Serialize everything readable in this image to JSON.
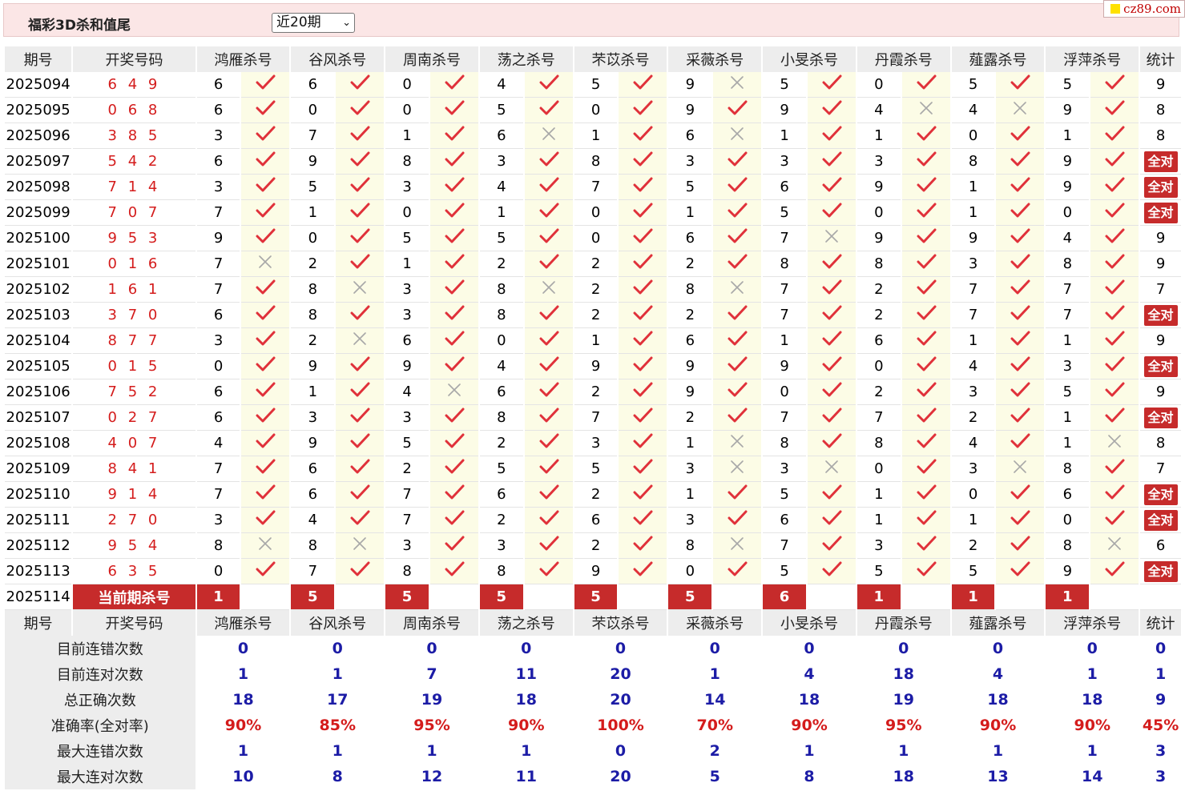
{
  "header": {
    "title": "福彩3D杀和值尾",
    "select_value": "近20期",
    "site_badge": "cz89.com"
  },
  "columns": {
    "period": "期号",
    "drawn": "开奖号码",
    "experts": [
      "鸿雁杀号",
      "谷风杀号",
      "周南杀号",
      "荡之杀号",
      "芣苡杀号",
      "采薇杀号",
      "小旻杀号",
      "丹霞杀号",
      "薤露杀号",
      "浮萍杀号"
    ],
    "stats": "统计"
  },
  "full_label": "全对",
  "rows": [
    {
      "period": "2025094",
      "drawn": "6 4 9",
      "picks": [
        6,
        6,
        0,
        4,
        5,
        9,
        5,
        0,
        5,
        5
      ],
      "marks": [
        1,
        1,
        1,
        1,
        1,
        0,
        1,
        1,
        1,
        1
      ],
      "stat": "9"
    },
    {
      "period": "2025095",
      "drawn": "0 6 8",
      "picks": [
        6,
        0,
        0,
        5,
        0,
        9,
        9,
        4,
        4,
        9
      ],
      "marks": [
        1,
        1,
        1,
        1,
        1,
        1,
        1,
        0,
        0,
        1
      ],
      "stat": "8"
    },
    {
      "period": "2025096",
      "drawn": "3 8 5",
      "picks": [
        3,
        7,
        1,
        6,
        1,
        6,
        1,
        1,
        0,
        1
      ],
      "marks": [
        1,
        1,
        1,
        0,
        1,
        0,
        1,
        1,
        1,
        1
      ],
      "stat": "8"
    },
    {
      "period": "2025097",
      "drawn": "5 4 2",
      "picks": [
        6,
        9,
        8,
        3,
        8,
        3,
        3,
        3,
        8,
        9
      ],
      "marks": [
        1,
        1,
        1,
        1,
        1,
        1,
        1,
        1,
        1,
        1
      ],
      "stat": "全对"
    },
    {
      "period": "2025098",
      "drawn": "7 1 4",
      "picks": [
        3,
        5,
        3,
        4,
        7,
        5,
        6,
        9,
        1,
        9
      ],
      "marks": [
        1,
        1,
        1,
        1,
        1,
        1,
        1,
        1,
        1,
        1
      ],
      "stat": "全对"
    },
    {
      "period": "2025099",
      "drawn": "7 0 7",
      "picks": [
        7,
        1,
        0,
        1,
        0,
        1,
        5,
        0,
        1,
        0
      ],
      "marks": [
        1,
        1,
        1,
        1,
        1,
        1,
        1,
        1,
        1,
        1
      ],
      "stat": "全对"
    },
    {
      "period": "2025100",
      "drawn": "9 5 3",
      "picks": [
        9,
        0,
        5,
        5,
        0,
        6,
        7,
        9,
        9,
        4
      ],
      "marks": [
        1,
        1,
        1,
        1,
        1,
        1,
        0,
        1,
        1,
        1
      ],
      "stat": "9"
    },
    {
      "period": "2025101",
      "drawn": "0 1 6",
      "picks": [
        7,
        2,
        1,
        2,
        2,
        2,
        8,
        8,
        3,
        8
      ],
      "marks": [
        0,
        1,
        1,
        1,
        1,
        1,
        1,
        1,
        1,
        1
      ],
      "stat": "9"
    },
    {
      "period": "2025102",
      "drawn": "1 6 1",
      "picks": [
        7,
        8,
        3,
        8,
        2,
        8,
        7,
        2,
        7,
        7
      ],
      "marks": [
        1,
        0,
        1,
        0,
        1,
        0,
        1,
        1,
        1,
        1
      ],
      "stat": "7"
    },
    {
      "period": "2025103",
      "drawn": "3 7 0",
      "picks": [
        6,
        8,
        3,
        8,
        2,
        2,
        7,
        2,
        7,
        7
      ],
      "marks": [
        1,
        1,
        1,
        1,
        1,
        1,
        1,
        1,
        1,
        1
      ],
      "stat": "全对"
    },
    {
      "period": "2025104",
      "drawn": "8 7 7",
      "picks": [
        3,
        2,
        6,
        0,
        1,
        6,
        1,
        6,
        1,
        1
      ],
      "marks": [
        1,
        0,
        1,
        1,
        1,
        1,
        1,
        1,
        1,
        1
      ],
      "stat": "9"
    },
    {
      "period": "2025105",
      "drawn": "0 1 5",
      "picks": [
        0,
        9,
        9,
        4,
        9,
        9,
        9,
        0,
        4,
        3
      ],
      "marks": [
        1,
        1,
        1,
        1,
        1,
        1,
        1,
        1,
        1,
        1
      ],
      "stat": "全对"
    },
    {
      "period": "2025106",
      "drawn": "7 5 2",
      "picks": [
        6,
        1,
        4,
        6,
        2,
        9,
        0,
        2,
        3,
        5
      ],
      "marks": [
        1,
        1,
        0,
        1,
        1,
        1,
        1,
        1,
        1,
        1
      ],
      "stat": "9"
    },
    {
      "period": "2025107",
      "drawn": "0 2 7",
      "picks": [
        6,
        3,
        3,
        8,
        7,
        2,
        7,
        7,
        2,
        1
      ],
      "marks": [
        1,
        1,
        1,
        1,
        1,
        1,
        1,
        1,
        1,
        1
      ],
      "stat": "全对"
    },
    {
      "period": "2025108",
      "drawn": "4 0 7",
      "picks": [
        4,
        9,
        5,
        2,
        3,
        1,
        8,
        8,
        4,
        1
      ],
      "marks": [
        1,
        1,
        1,
        1,
        1,
        0,
        1,
        1,
        1,
        0
      ],
      "stat": "8"
    },
    {
      "period": "2025109",
      "drawn": "8 4 1",
      "picks": [
        7,
        6,
        2,
        5,
        5,
        3,
        3,
        0,
        3,
        8
      ],
      "marks": [
        1,
        1,
        1,
        1,
        1,
        0,
        0,
        1,
        0,
        1
      ],
      "stat": "7"
    },
    {
      "period": "2025110",
      "drawn": "9 1 4",
      "picks": [
        7,
        6,
        7,
        6,
        2,
        1,
        5,
        1,
        0,
        6
      ],
      "marks": [
        1,
        1,
        1,
        1,
        1,
        1,
        1,
        1,
        1,
        1
      ],
      "stat": "全对"
    },
    {
      "period": "2025111",
      "drawn": "2 7 0",
      "picks": [
        3,
        4,
        7,
        2,
        6,
        3,
        6,
        1,
        1,
        0
      ],
      "marks": [
        1,
        1,
        1,
        1,
        1,
        1,
        1,
        1,
        1,
        1
      ],
      "stat": "全对"
    },
    {
      "period": "2025112",
      "drawn": "9 5 4",
      "picks": [
        8,
        8,
        3,
        3,
        2,
        8,
        7,
        3,
        2,
        8
      ],
      "marks": [
        0,
        0,
        1,
        1,
        1,
        0,
        1,
        1,
        1,
        0
      ],
      "stat": "6"
    },
    {
      "period": "2025113",
      "drawn": "6 3 5",
      "picks": [
        0,
        7,
        8,
        8,
        9,
        0,
        5,
        5,
        5,
        9
      ],
      "marks": [
        1,
        1,
        1,
        1,
        1,
        1,
        1,
        1,
        1,
        1
      ],
      "stat": "全对"
    }
  ],
  "current": {
    "period": "2025114",
    "label": "当前期杀号",
    "picks": [
      1,
      5,
      5,
      5,
      5,
      5,
      6,
      1,
      1,
      1
    ]
  },
  "summary": [
    {
      "label": "目前连错次数",
      "values": [
        "0",
        "0",
        "0",
        "0",
        "0",
        "0",
        "0",
        "0",
        "0",
        "0",
        "0"
      ]
    },
    {
      "label": "目前连对次数",
      "values": [
        "1",
        "1",
        "7",
        "11",
        "20",
        "1",
        "4",
        "18",
        "4",
        "1",
        "1"
      ]
    },
    {
      "label": "总正确次数",
      "values": [
        "18",
        "17",
        "19",
        "18",
        "20",
        "14",
        "18",
        "19",
        "18",
        "18",
        "9"
      ]
    },
    {
      "label": "准确率(全对率)",
      "values": [
        "90%",
        "85%",
        "95%",
        "90%",
        "100%",
        "70%",
        "90%",
        "95%",
        "90%",
        "90%",
        "45%"
      ],
      "rate": true
    },
    {
      "label": "最大连错次数",
      "values": [
        "1",
        "1",
        "1",
        "1",
        "0",
        "2",
        "1",
        "1",
        "1",
        "1",
        "3"
      ]
    },
    {
      "label": "最大连对次数",
      "values": [
        "10",
        "8",
        "12",
        "11",
        "20",
        "5",
        "8",
        "18",
        "13",
        "14",
        "3"
      ]
    }
  ],
  "colors": {
    "accent_red": "#c62b2b",
    "check_red": "#e0313a",
    "cross_gray": "#a8a8a8",
    "stat_blue": "#1c1ca6"
  }
}
